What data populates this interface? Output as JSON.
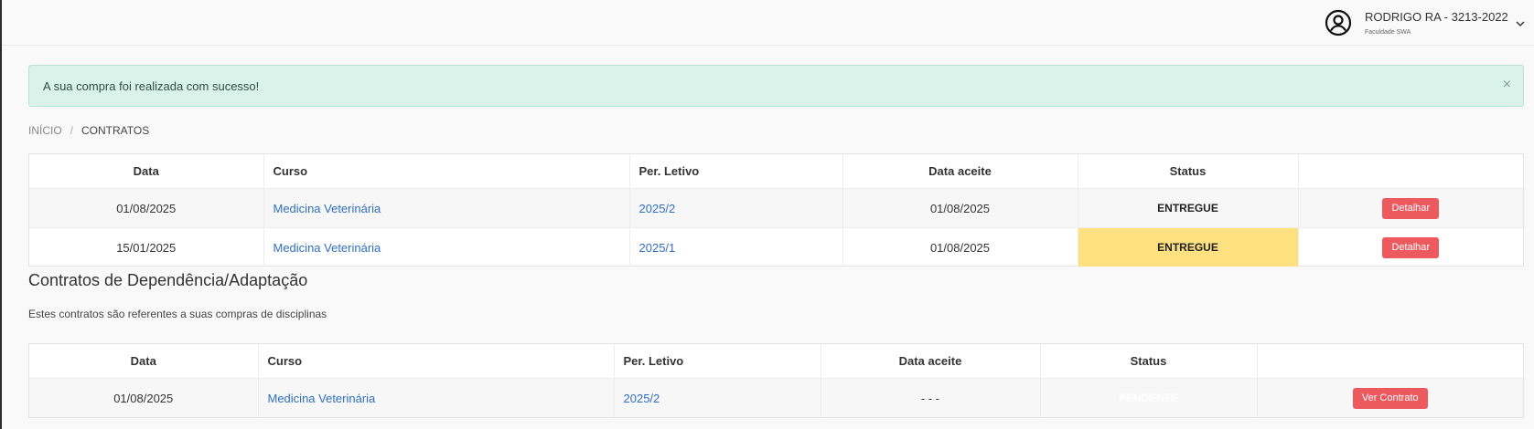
{
  "header": {
    "user_name": "RODRIGO RA - 3213-2022",
    "institution": "Faculdade SWA"
  },
  "alert": {
    "message": "A sua compra foi realizada com sucesso!",
    "close_symbol": "×"
  },
  "breadcrumb": {
    "home": "INÍCIO",
    "separator": "/",
    "current": "CONTRATOS"
  },
  "contracts_table": {
    "columns": [
      "Data",
      "Curso",
      "Per. Letivo",
      "Data aceite",
      "Status",
      ""
    ],
    "rows": [
      {
        "data": "01/08/2025",
        "curso": "Medicina Veterinária",
        "periodo": "2025/2",
        "data_aceite": "01/08/2025",
        "status": "ENTREGUE",
        "action": "Detalhar"
      },
      {
        "data": "15/01/2025",
        "curso": "Medicina Veterinária",
        "periodo": "2025/1",
        "data_aceite": "01/08/2025",
        "status": "ENTREGUE",
        "action": "Detalhar"
      }
    ]
  },
  "dependency_section": {
    "title": "Contratos de Dependência/Adaptação",
    "description": "Estes contratos são referentes a suas compras de disciplinas"
  },
  "dependency_table": {
    "columns": [
      "Data",
      "Curso",
      "Per. Letivo",
      "Data aceite",
      "Status",
      ""
    ],
    "rows": [
      {
        "data": "01/08/2025",
        "curso": "Medicina Veterinária",
        "periodo": "2025/2",
        "data_aceite": "- - -",
        "status": "PENDENTE",
        "action": "Ver Contrato"
      }
    ]
  },
  "colors": {
    "alert_bg": "#d9f2ea",
    "status_entregue": "#fde080",
    "status_pendente": "#99b8e0",
    "action_button": "#ec5a5f",
    "link": "#2f6fbf"
  },
  "icons": {
    "avatar": "user-circle-icon",
    "dropdown": "chevron-down-icon",
    "close": "close-icon"
  }
}
